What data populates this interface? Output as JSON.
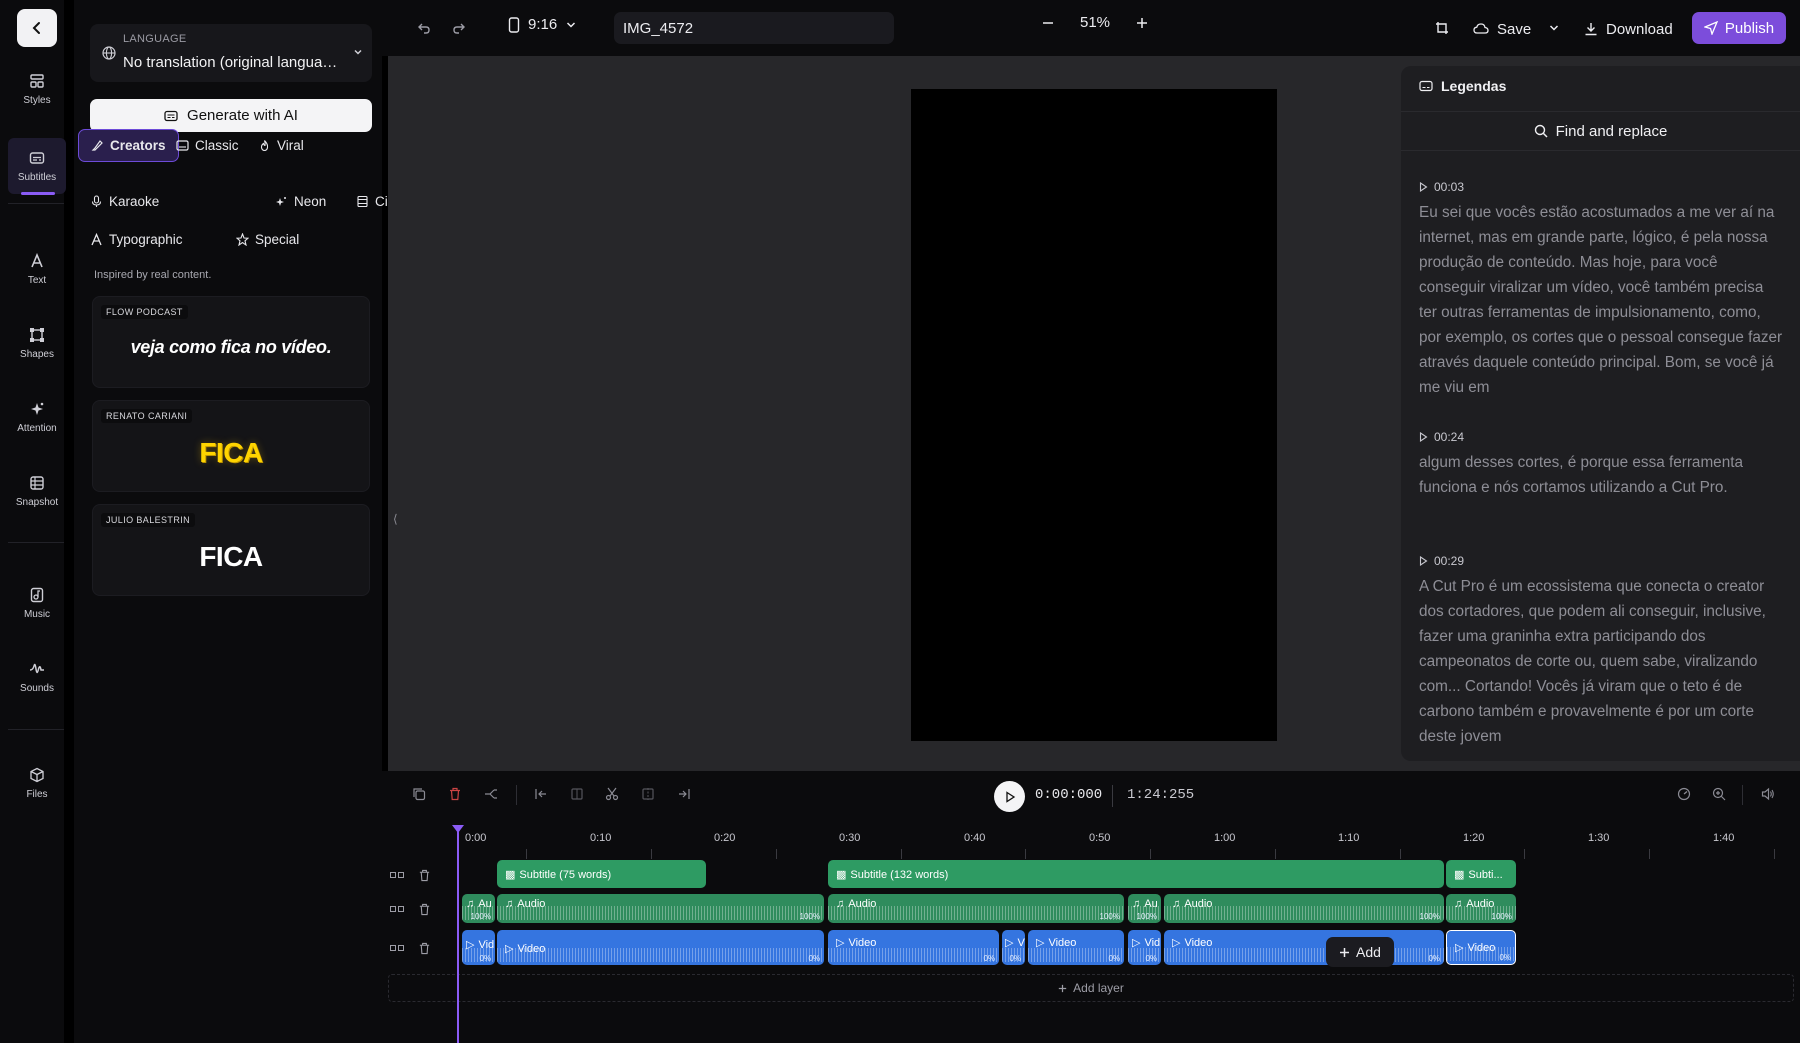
{
  "rail": {
    "items": [
      {
        "label": "Styles",
        "icon": "styles-icon"
      },
      {
        "label": "Subtitles",
        "icon": "subtitles-icon"
      },
      {
        "label": "Text",
        "icon": "text-icon"
      },
      {
        "label": "Shapes",
        "icon": "shapes-icon"
      },
      {
        "label": "Attention",
        "icon": "attention-icon"
      },
      {
        "label": "Snapshot",
        "icon": "snapshot-icon"
      },
      {
        "label": "Music",
        "icon": "music-icon"
      },
      {
        "label": "Sounds",
        "icon": "sounds-icon"
      },
      {
        "label": "Files",
        "icon": "files-icon"
      }
    ],
    "active": "Subtitles"
  },
  "panel": {
    "language_caption": "LANGUAGE",
    "language_value": "No translation (original language)",
    "generate_label": "Generate with AI",
    "chips": [
      "Creators",
      "Classic",
      "Viral",
      "Karaoke",
      "Neon",
      "Cinema",
      "Typographic",
      "Special"
    ],
    "active_chip": "Creators",
    "inspired": "Inspired by real content.",
    "cards": [
      {
        "tag": "FLOW PODCAST",
        "preview": "veja como fica no vídeo."
      },
      {
        "tag": "RENATO CARIANI",
        "preview": "FICA"
      },
      {
        "tag": "JULIO BALESTRIN",
        "preview": "FICA"
      }
    ]
  },
  "topbar": {
    "aspect": "9:16",
    "project_name": "IMG_4572",
    "zoom": "51%",
    "save_label": "Save",
    "download_label": "Download",
    "publish_label": "Publish"
  },
  "subtitles_panel": {
    "title": "Legendas",
    "find_label": "Find and replace",
    "segments": [
      {
        "time": "00:03",
        "text": "Eu sei que vocês estão acostumados a me ver aí na internet, mas em grande parte, lógico, é pela nossa produção de conteúdo. Mas hoje, para você conseguir viralizar um vídeo, você também precisa ter outras ferramentas de impulsionamento, como, por exemplo, os cortes que o pessoal consegue fazer através daquele conteúdo principal. Bom, se você já me viu em"
      },
      {
        "time": "00:24",
        "text": "algum desses cortes, é porque essa ferramenta funciona e nós cortamos utilizando a Cut Pro."
      },
      {
        "time": "00:29",
        "text": "A Cut Pro é um ecossistema que conecta o creator dos cortadores, que podem ali conseguir, inclusive, fazer uma graninha extra participando dos campeonatos de corte ou, quem sabe, viralizando com... Cortando! Vocês já viram que o teto é de carbono também e provavelmente é por um corte deste jovem"
      }
    ]
  },
  "timeline": {
    "current_time": "0:00:000",
    "total_time": "1:24:255",
    "ticks": [
      "0:00",
      "0:10",
      "0:20",
      "0:30",
      "0:40",
      "0:50",
      "1:00",
      "1:10",
      "1:20",
      "1:30",
      "1:40"
    ],
    "subtitle_clips": [
      "Subtitle (75 words)",
      "Subtitle (132 words)",
      "Subti..."
    ],
    "audio_clip_label": "Audio",
    "audio_clip_short": "Au",
    "video_clip_label": "Video",
    "video_clip_short": "Vid",
    "video_clip_tiny": "V",
    "volume_full": "100%",
    "volume_zero": "0%",
    "add_label": "Add",
    "add_layer_label": "Add layer"
  },
  "colors": {
    "accent": "#8b5cf6",
    "publish": "#7c4ddb",
    "subtitle_clip": "#2e9b63",
    "audio_clip": "#2f8c5d",
    "video_clip": "#3575e0",
    "canvas_bg": "#27272a",
    "rail_bg": "#0b0b0d"
  }
}
